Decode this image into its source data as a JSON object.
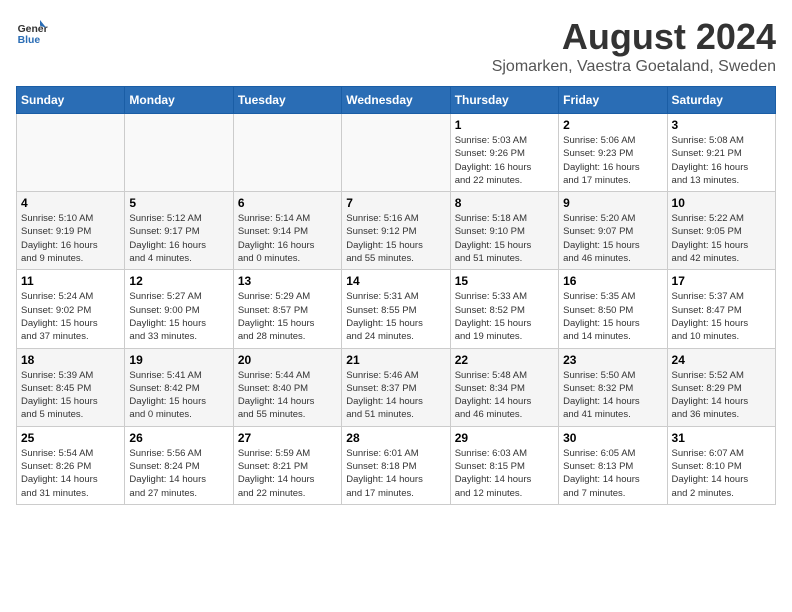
{
  "logo": {
    "text_general": "General",
    "text_blue": "Blue"
  },
  "title": "August 2024",
  "subtitle": "Sjomarken, Vaestra Goetaland, Sweden",
  "columns": [
    "Sunday",
    "Monday",
    "Tuesday",
    "Wednesday",
    "Thursday",
    "Friday",
    "Saturday"
  ],
  "weeks": [
    [
      {
        "day": "",
        "info": ""
      },
      {
        "day": "",
        "info": ""
      },
      {
        "day": "",
        "info": ""
      },
      {
        "day": "",
        "info": ""
      },
      {
        "day": "1",
        "info": "Sunrise: 5:03 AM\nSunset: 9:26 PM\nDaylight: 16 hours\nand 22 minutes."
      },
      {
        "day": "2",
        "info": "Sunrise: 5:06 AM\nSunset: 9:23 PM\nDaylight: 16 hours\nand 17 minutes."
      },
      {
        "day": "3",
        "info": "Sunrise: 5:08 AM\nSunset: 9:21 PM\nDaylight: 16 hours\nand 13 minutes."
      }
    ],
    [
      {
        "day": "4",
        "info": "Sunrise: 5:10 AM\nSunset: 9:19 PM\nDaylight: 16 hours\nand 9 minutes."
      },
      {
        "day": "5",
        "info": "Sunrise: 5:12 AM\nSunset: 9:17 PM\nDaylight: 16 hours\nand 4 minutes."
      },
      {
        "day": "6",
        "info": "Sunrise: 5:14 AM\nSunset: 9:14 PM\nDaylight: 16 hours\nand 0 minutes."
      },
      {
        "day": "7",
        "info": "Sunrise: 5:16 AM\nSunset: 9:12 PM\nDaylight: 15 hours\nand 55 minutes."
      },
      {
        "day": "8",
        "info": "Sunrise: 5:18 AM\nSunset: 9:10 PM\nDaylight: 15 hours\nand 51 minutes."
      },
      {
        "day": "9",
        "info": "Sunrise: 5:20 AM\nSunset: 9:07 PM\nDaylight: 15 hours\nand 46 minutes."
      },
      {
        "day": "10",
        "info": "Sunrise: 5:22 AM\nSunset: 9:05 PM\nDaylight: 15 hours\nand 42 minutes."
      }
    ],
    [
      {
        "day": "11",
        "info": "Sunrise: 5:24 AM\nSunset: 9:02 PM\nDaylight: 15 hours\nand 37 minutes."
      },
      {
        "day": "12",
        "info": "Sunrise: 5:27 AM\nSunset: 9:00 PM\nDaylight: 15 hours\nand 33 minutes."
      },
      {
        "day": "13",
        "info": "Sunrise: 5:29 AM\nSunset: 8:57 PM\nDaylight: 15 hours\nand 28 minutes."
      },
      {
        "day": "14",
        "info": "Sunrise: 5:31 AM\nSunset: 8:55 PM\nDaylight: 15 hours\nand 24 minutes."
      },
      {
        "day": "15",
        "info": "Sunrise: 5:33 AM\nSunset: 8:52 PM\nDaylight: 15 hours\nand 19 minutes."
      },
      {
        "day": "16",
        "info": "Sunrise: 5:35 AM\nSunset: 8:50 PM\nDaylight: 15 hours\nand 14 minutes."
      },
      {
        "day": "17",
        "info": "Sunrise: 5:37 AM\nSunset: 8:47 PM\nDaylight: 15 hours\nand 10 minutes."
      }
    ],
    [
      {
        "day": "18",
        "info": "Sunrise: 5:39 AM\nSunset: 8:45 PM\nDaylight: 15 hours\nand 5 minutes."
      },
      {
        "day": "19",
        "info": "Sunrise: 5:41 AM\nSunset: 8:42 PM\nDaylight: 15 hours\nand 0 minutes."
      },
      {
        "day": "20",
        "info": "Sunrise: 5:44 AM\nSunset: 8:40 PM\nDaylight: 14 hours\nand 55 minutes."
      },
      {
        "day": "21",
        "info": "Sunrise: 5:46 AM\nSunset: 8:37 PM\nDaylight: 14 hours\nand 51 minutes."
      },
      {
        "day": "22",
        "info": "Sunrise: 5:48 AM\nSunset: 8:34 PM\nDaylight: 14 hours\nand 46 minutes."
      },
      {
        "day": "23",
        "info": "Sunrise: 5:50 AM\nSunset: 8:32 PM\nDaylight: 14 hours\nand 41 minutes."
      },
      {
        "day": "24",
        "info": "Sunrise: 5:52 AM\nSunset: 8:29 PM\nDaylight: 14 hours\nand 36 minutes."
      }
    ],
    [
      {
        "day": "25",
        "info": "Sunrise: 5:54 AM\nSunset: 8:26 PM\nDaylight: 14 hours\nand 31 minutes."
      },
      {
        "day": "26",
        "info": "Sunrise: 5:56 AM\nSunset: 8:24 PM\nDaylight: 14 hours\nand 27 minutes."
      },
      {
        "day": "27",
        "info": "Sunrise: 5:59 AM\nSunset: 8:21 PM\nDaylight: 14 hours\nand 22 minutes."
      },
      {
        "day": "28",
        "info": "Sunrise: 6:01 AM\nSunset: 8:18 PM\nDaylight: 14 hours\nand 17 minutes."
      },
      {
        "day": "29",
        "info": "Sunrise: 6:03 AM\nSunset: 8:15 PM\nDaylight: 14 hours\nand 12 minutes."
      },
      {
        "day": "30",
        "info": "Sunrise: 6:05 AM\nSunset: 8:13 PM\nDaylight: 14 hours\nand 7 minutes."
      },
      {
        "day": "31",
        "info": "Sunrise: 6:07 AM\nSunset: 8:10 PM\nDaylight: 14 hours\nand 2 minutes."
      }
    ]
  ]
}
